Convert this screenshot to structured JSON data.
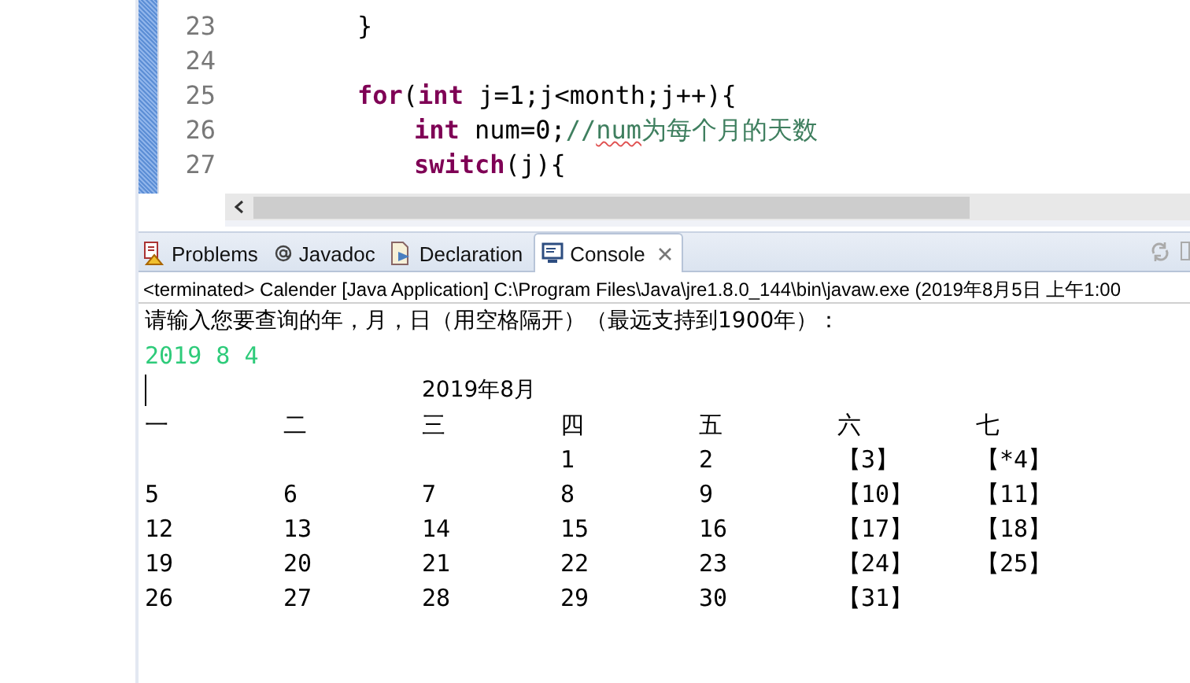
{
  "editor": {
    "lines": [
      {
        "number": "23",
        "tokens": [
          {
            "kind": "plain",
            "text": "}"
          }
        ]
      },
      {
        "number": "24"
      },
      {
        "number": "25",
        "tokens": [
          {
            "kind": "keyword",
            "text": "for"
          },
          {
            "kind": "plain",
            "text": "("
          },
          {
            "kind": "keyword",
            "text": "int"
          },
          {
            "kind": "plain",
            "text": " j=1;j<month;j++){"
          }
        ],
        "children": [
          {
            "number": "26",
            "tokens": [
              {
                "kind": "keyword",
                "text": "int"
              },
              {
                "kind": "plain",
                "text": " num=0;"
              },
              {
                "kind": "comment",
                "text": "//"
              },
              {
                "kind": "misspelled",
                "text": "num"
              },
              {
                "kind": "comment",
                "text": "为每个月的天数"
              }
            ]
          },
          {
            "number": "27",
            "tokens": [
              {
                "kind": "keyword",
                "text": "switch"
              },
              {
                "kind": "plain",
                "text": "(j){"
              }
            ]
          }
        ]
      }
    ]
  },
  "tabs": [
    {
      "label": "Problems",
      "selected": false,
      "closable": false
    },
    {
      "label": "Javadoc",
      "selected": false,
      "closable": false
    },
    {
      "label": "Declaration",
      "selected": false,
      "closable": false
    },
    {
      "label": "Console",
      "selected": true,
      "closable": true
    }
  ],
  "console": {
    "status": "<terminated> Calender [Java Application] C:\\Program Files\\Java\\jre1.8.0_144\\bin\\javaw.exe (2019年8月5日 上午1:00",
    "prompt": "请输入您要查询的年，月，日（用空格隔开）（最远支持到1900年）：",
    "input": "2019 8 4",
    "calendar_title": "2019年8月",
    "weekdays": [
      "一",
      "二",
      "三",
      "四",
      "五",
      "六",
      "七"
    ],
    "weeks": [
      [
        {
          "kind": "blank"
        },
        {
          "kind": "blank"
        },
        {
          "kind": "blank"
        },
        {
          "kind": "day",
          "text": "1"
        },
        {
          "kind": "day",
          "text": "2"
        },
        {
          "kind": "day",
          "text": "【3】"
        },
        {
          "kind": "day",
          "text": "【*4】"
        }
      ],
      [
        {
          "kind": "day",
          "text": "5"
        },
        {
          "kind": "day",
          "text": "6"
        },
        {
          "kind": "day",
          "text": "7"
        },
        {
          "kind": "day",
          "text": "8"
        },
        {
          "kind": "day",
          "text": "9"
        },
        {
          "kind": "day",
          "text": "【10】"
        },
        {
          "kind": "day",
          "text": "【11】"
        }
      ],
      [
        {
          "kind": "day",
          "text": "12"
        },
        {
          "kind": "day",
          "text": "13"
        },
        {
          "kind": "day",
          "text": "14"
        },
        {
          "kind": "day",
          "text": "15"
        },
        {
          "kind": "day",
          "text": "16"
        },
        {
          "kind": "day",
          "text": "【17】"
        },
        {
          "kind": "day",
          "text": "【18】"
        }
      ],
      [
        {
          "kind": "day",
          "text": "19"
        },
        {
          "kind": "day",
          "text": "20"
        },
        {
          "kind": "day",
          "text": "21"
        },
        {
          "kind": "day",
          "text": "22"
        },
        {
          "kind": "day",
          "text": "23"
        },
        {
          "kind": "day",
          "text": "【24】"
        },
        {
          "kind": "day",
          "text": "【25】"
        }
      ],
      [
        {
          "kind": "day",
          "text": "26"
        },
        {
          "kind": "day",
          "text": "27"
        },
        {
          "kind": "day",
          "text": "28"
        },
        {
          "kind": "day",
          "text": "29"
        },
        {
          "kind": "day",
          "text": "30"
        },
        {
          "kind": "day",
          "text": "【31】"
        }
      ]
    ]
  }
}
